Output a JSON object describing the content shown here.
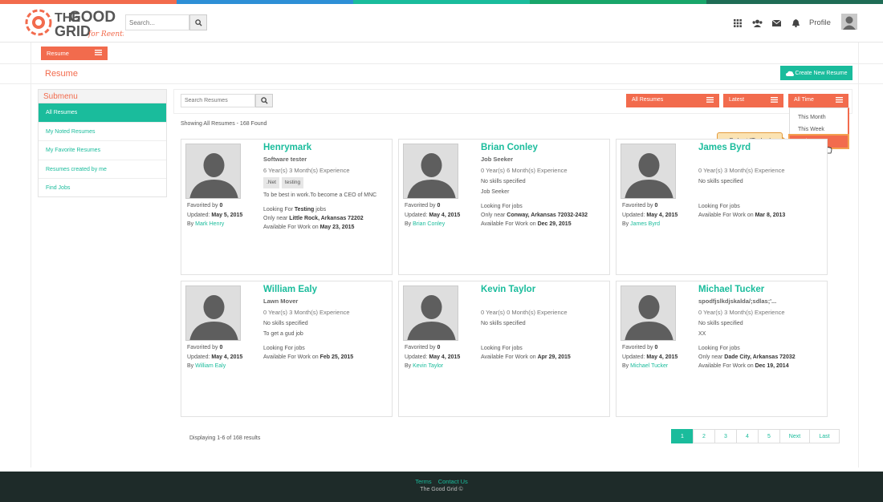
{
  "brand": {
    "logo_title": "THE GOOD GRID",
    "logo_sub": "for Reentry",
    "colors": [
      "#f26b4d",
      "#2d8fd6",
      "#1abc9c",
      "#18a66a",
      "#1f6c55"
    ]
  },
  "header": {
    "search_placeholder": "Search...",
    "profile_label": "Profile",
    "icons": [
      "grid-icon",
      "users-icon",
      "envelope-icon",
      "bell-icon"
    ]
  },
  "tab": {
    "label": "Resume"
  },
  "page": {
    "title": "Resume",
    "create_button": "Create New Resume"
  },
  "submenu": {
    "title": "Submenu",
    "items": [
      "All Resumes",
      "My Noted Resumes",
      "My Favorite Resumes",
      "Resumes created by me",
      "Find Jobs"
    ]
  },
  "filters": {
    "search_placeholder": "Search Resumes",
    "category": "All Resumes",
    "sort": "Latest",
    "time": "All Time",
    "time_options": [
      "This Month",
      "This Week",
      "Today"
    ]
  },
  "tooltip": "Select 'Today'",
  "showing": "Showing All Resumes - 168 Found",
  "cards": [
    {
      "name": "Henrymark",
      "title": "Software tester",
      "exp": "6 Year(s) 3 Month(s) Experience",
      "skills": [
        ".Net",
        "testing"
      ],
      "objective": "To be best in work.To become a CEO of MNC",
      "looking_prefix": "Looking For ",
      "looking_bold": "Testing",
      "looking_suffix": " jobs",
      "near_prefix": "Only near ",
      "near": "Little Rock, Arkansas 72202",
      "avail": "May 23, 2015",
      "favorited": "0",
      "updated": "May 5, 2015",
      "by": "Mark Henry"
    },
    {
      "name": "Brian Conley",
      "title": "Job Seeker",
      "exp": "0 Year(s) 6 Month(s) Experience",
      "skills": [],
      "skills_text": "No skills specified",
      "objective": "Job Seeker",
      "looking_prefix": "Looking For jobs",
      "looking_bold": "",
      "looking_suffix": "",
      "near_prefix": "Only near ",
      "near": "Conway, Arkansas 72032-2432",
      "avail": "Dec 29, 2015",
      "favorited": "0",
      "updated": "May 4, 2015",
      "by": "Brian Conley"
    },
    {
      "name": "James Byrd",
      "title": "",
      "exp": "0 Year(s) 3 Month(s) Experience",
      "skills": [],
      "skills_text": "No skills specified",
      "objective": "",
      "looking_prefix": "Looking For jobs",
      "looking_bold": "",
      "looking_suffix": "",
      "near_prefix": "",
      "near": "",
      "avail": "Mar 8, 2013",
      "favorited": "0",
      "updated": "May 4, 2015",
      "by": "James Byrd"
    },
    {
      "name": "William Ealy",
      "title": "Lawn Mover",
      "exp": "0 Year(s) 3 Month(s) Experience",
      "skills": [],
      "skills_text": "No skills specified",
      "objective": "To get a gud job",
      "looking_prefix": "Looking For jobs",
      "looking_bold": "",
      "looking_suffix": "",
      "near_prefix": "",
      "near": "",
      "avail": "Feb 25, 2015",
      "favorited": "0",
      "updated": "May 4, 2015",
      "by": "William Ealy"
    },
    {
      "name": "Kevin Taylor",
      "title": "",
      "exp": "0 Year(s) 0 Month(s) Experience",
      "skills": [],
      "skills_text": "No skills specified",
      "objective": "",
      "looking_prefix": "Looking For jobs",
      "looking_bold": "",
      "looking_suffix": "",
      "near_prefix": "",
      "near": "",
      "avail": "Apr 29, 2015",
      "favorited": "0",
      "updated": "May 4, 2015",
      "by": "Kevin Taylor"
    },
    {
      "name": "Michael Tucker",
      "title": "spodfjslkdjskalda/;sdlas;'...",
      "exp": "0 Year(s) 3 Month(s) Experience",
      "skills": [],
      "skills_text": "No skills specified",
      "objective": "XX",
      "looking_prefix": "Looking For jobs",
      "looking_bold": "",
      "looking_suffix": "",
      "near_prefix": "Only near ",
      "near": "Dade City, Arkansas 72032",
      "avail": "Dec 19, 2014",
      "favorited": "0",
      "updated": "May 4, 2015",
      "by": "Michael Tucker"
    }
  ],
  "labels": {
    "favorited": "Favorited by ",
    "updated": "Updated: ",
    "by": "By ",
    "avail": "Available For Work on "
  },
  "pagination": {
    "displaying": "Displaying 1-6 of 168 results",
    "pages": [
      "1",
      "2",
      "3",
      "4",
      "5"
    ],
    "next": "Next",
    "last": "Last",
    "current": "1"
  },
  "footer": {
    "links": [
      "Terms",
      "Contact Us"
    ],
    "copyright": "The Good Grid ©"
  }
}
